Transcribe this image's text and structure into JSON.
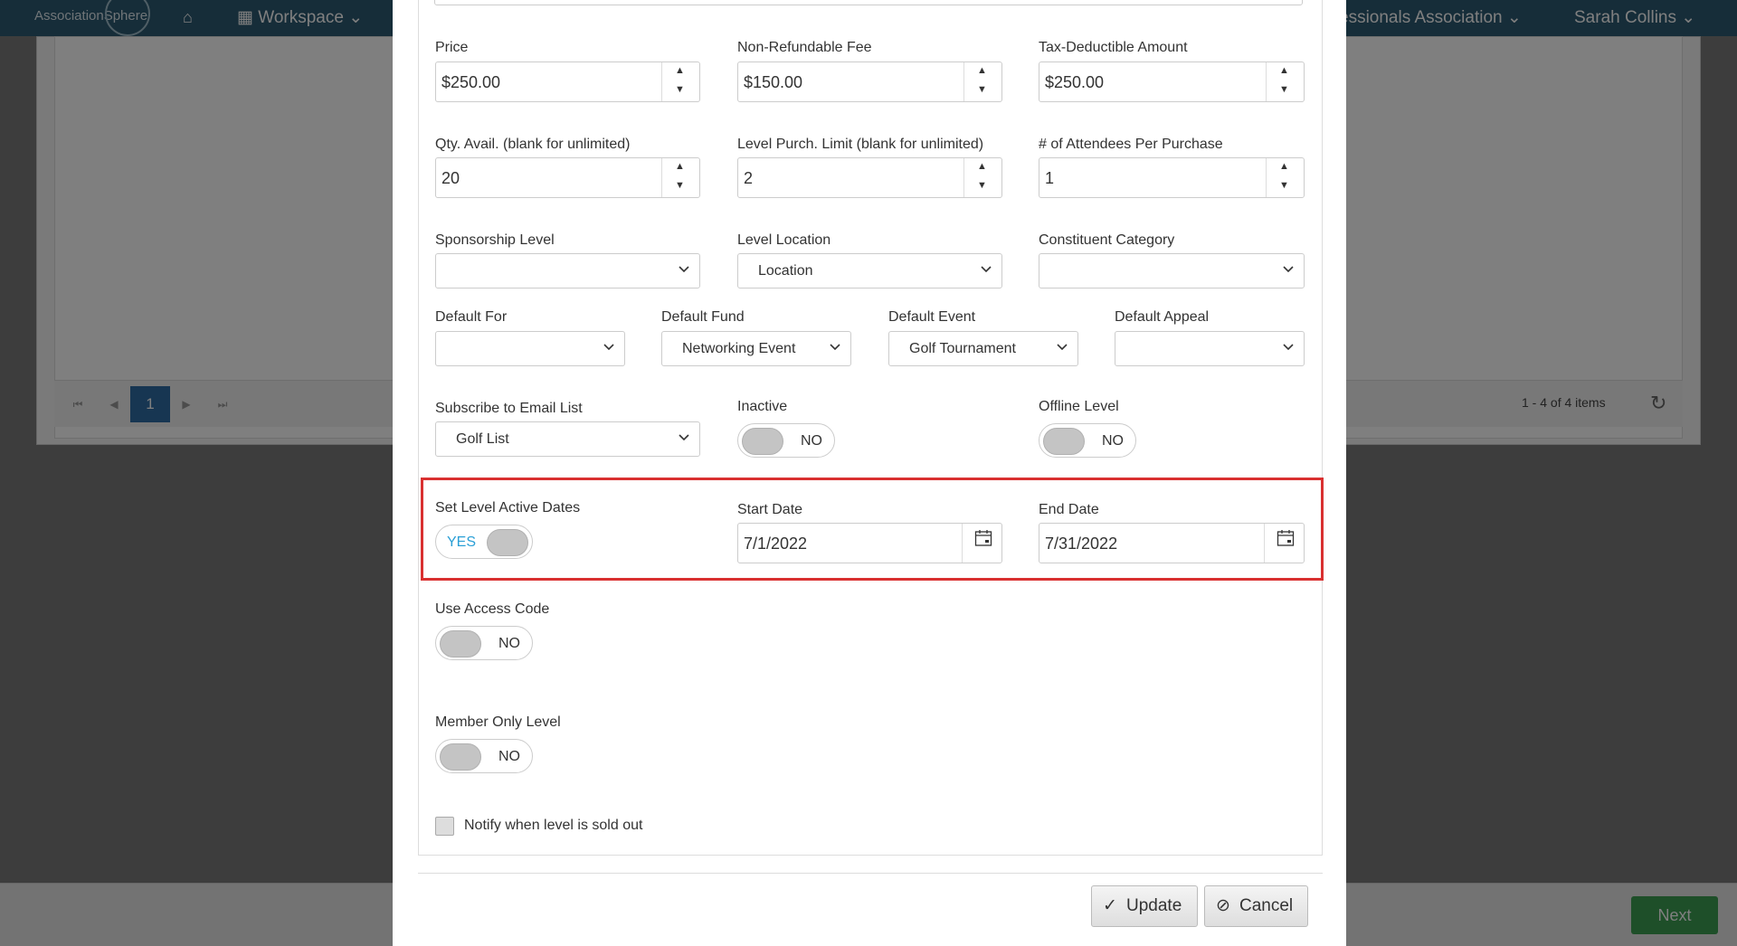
{
  "topnav": {
    "brand": "AssociationSphere",
    "home_icon": "⌂",
    "workspace_label": "Workspace",
    "org_label": "essionals Association",
    "user_label": "Sarah Collins"
  },
  "background": {
    "pager_page": "1",
    "pager_info": "1 - 4 of 4 items",
    "next_label": "Next"
  },
  "form": {
    "price": {
      "label": "Price",
      "value": "$250.00"
    },
    "non_refundable_fee": {
      "label": "Non-Refundable Fee",
      "value": "$150.00"
    },
    "tax_deductible": {
      "label": "Tax-Deductible Amount",
      "value": "$250.00"
    },
    "qty_avail": {
      "label": "Qty. Avail. (blank for unlimited)",
      "value": "20"
    },
    "purch_limit": {
      "label": "Level Purch. Limit (blank for unlimited)",
      "value": "2"
    },
    "attendees": {
      "label": "# of Attendees Per Purchase",
      "value": "1"
    },
    "sponsorship_level": {
      "label": "Sponsorship Level",
      "value": ""
    },
    "level_location": {
      "label": "Level Location",
      "value": "Location"
    },
    "constituent_category": {
      "label": "Constituent Category",
      "value": ""
    },
    "default_for": {
      "label": "Default For",
      "value": ""
    },
    "default_fund": {
      "label": "Default Fund",
      "value": "Networking Event"
    },
    "default_event": {
      "label": "Default Event",
      "value": "Golf Tournament"
    },
    "default_appeal": {
      "label": "Default Appeal",
      "value": ""
    },
    "email_list": {
      "label": "Subscribe to Email List",
      "value": "Golf List"
    },
    "inactive": {
      "label": "Inactive",
      "state": "NO"
    },
    "offline": {
      "label": "Offline Level",
      "state": "NO"
    },
    "active_dates": {
      "label": "Set Level Active Dates",
      "state": "YES"
    },
    "start_date": {
      "label": "Start Date",
      "value": "7/1/2022"
    },
    "end_date": {
      "label": "End Date",
      "value": "7/31/2022"
    },
    "access_code": {
      "label": "Use Access Code",
      "state": "NO"
    },
    "member_only": {
      "label": "Member Only Level",
      "state": "NO"
    },
    "notify_label": "Notify when level is sold out"
  },
  "buttons": {
    "update": "Update",
    "cancel": "Cancel"
  },
  "colors": {
    "nav": "#2d5a72",
    "highlight": "#d93030",
    "toggle_yes": "#2a9fd6",
    "next": "#3c9e53"
  }
}
